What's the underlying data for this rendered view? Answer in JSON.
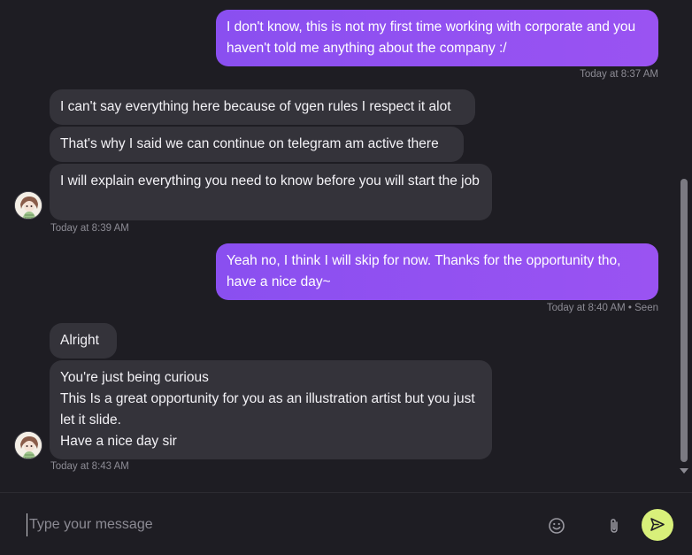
{
  "conversation": {
    "groups": [
      {
        "direction": "outgoing",
        "bubbles": [
          "I don't know, this is not my first time working with corporate and you haven't told me anything about the company :/"
        ],
        "time": "Today at 8:37 AM"
      },
      {
        "direction": "incoming",
        "bubbles": [
          "I can't say everything here because of vgen rules I respect it alot",
          "That's why I said we can continue on telegram am active there",
          "I will explain everything you need to know before you will start the job"
        ],
        "time": "Today at 8:39 AM"
      },
      {
        "direction": "outgoing",
        "bubbles": [
          "Yeah no, I think I will skip for now. Thanks for the opportunity tho, have a nice day~"
        ],
        "time": "Today at 8:40 AM",
        "seen": "Seen"
      },
      {
        "direction": "incoming",
        "bubbles": [
          "Alright",
          "You're just being curious\nThis Is a great opportunity for you as an illustration artist but you just let it slide.\nHave a nice day sir"
        ],
        "time": "Today at 8:43 AM"
      }
    ]
  },
  "composer": {
    "placeholder": "Type your message"
  },
  "colors": {
    "outgoing_bubble": "#9650f1",
    "incoming_bubble": "#34333a",
    "send_button": "#d8f07a",
    "background": "#1e1d23"
  },
  "icons": [
    "avatar",
    "emoji-icon",
    "paperclip-icon",
    "send-icon",
    "scroll-down-arrow-icon"
  ]
}
